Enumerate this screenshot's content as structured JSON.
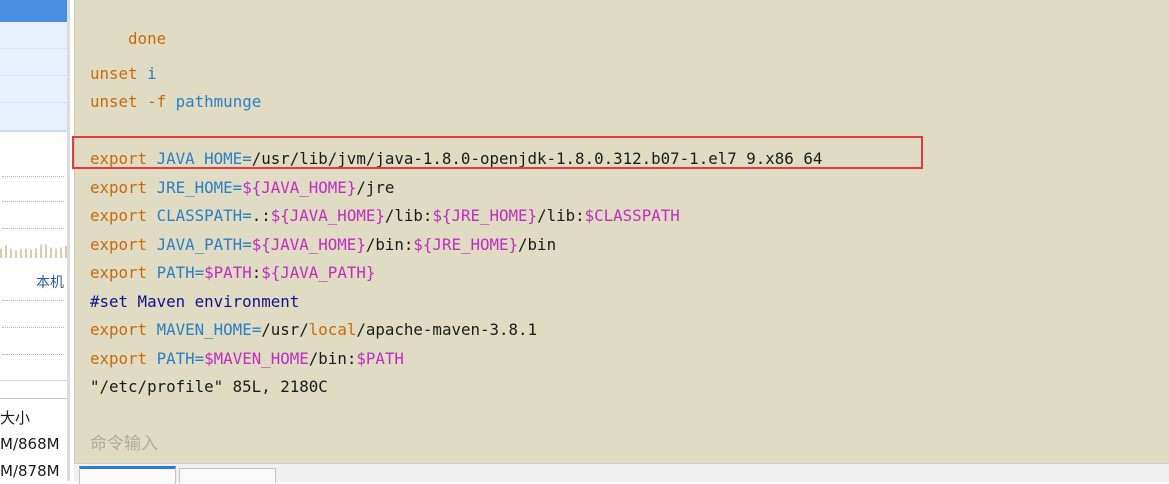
{
  "sidebar": {
    "local_label": "本机",
    "table": {
      "header": "大小",
      "rows": [
        "M/868M",
        "M/878M"
      ]
    }
  },
  "terminal": {
    "lines": {
      "done": "done",
      "unset_i": {
        "kw": "unset",
        "var": "i"
      },
      "unset_f": {
        "kw": "unset",
        "flag": "-f",
        "var": "pathmunge"
      },
      "java_home": {
        "kw": "export",
        "var": "JAVA_HOME=",
        "value": "/usr/lib/jvm/java-1.8.0-openjdk-1.8.0.312.b07-1.el7_9.x86_64"
      },
      "jre_home": {
        "kw": "export",
        "var": "JRE_HOME=",
        "ref": "${JAVA_HOME}",
        "tail": "/jre"
      },
      "classpath": {
        "kw": "export",
        "var": "CLASSPATH=",
        "dot": ".:",
        "ref1": "${JAVA_HOME}",
        "mid1": "/lib:",
        "ref2": "${JRE_HOME}",
        "mid2": "/lib:",
        "ref3": "$CLASSPATH"
      },
      "java_path": {
        "kw": "export",
        "var": "JAVA_PATH=",
        "ref1": "${JAVA_HOME}",
        "mid1": "/bin:",
        "ref2": "${JRE_HOME}",
        "tail": "/bin"
      },
      "path1": {
        "kw": "export",
        "var": "PATH=",
        "ref1": "$PATH",
        "mid": ":",
        "ref2": "${JAVA_PATH}"
      },
      "comment": {
        "hash": "#set",
        "rest": " Maven environment"
      },
      "maven_home": {
        "kw": "export",
        "var": "MAVEN_HOME=",
        "pre": "/usr/",
        "local": "local",
        "post": "/apache-maven-3.8.1"
      },
      "path2": {
        "kw": "export",
        "var": "PATH=",
        "ref1": "$MAVEN_HOME",
        "mid": "/bin:",
        "ref2": "$PATH"
      },
      "status": "\"/etc/profile\" 85L, 2180C"
    },
    "command_input_placeholder": "命令输入"
  },
  "colors": {
    "terminal_bg": "#e0dbc3",
    "keyword": "#c86a0a",
    "variable": "#2b7fc4",
    "string": "#c02ec0",
    "comment": "#12128a",
    "highlight_border": "#e23b3b",
    "sidebar_accent": "#4a90e2"
  }
}
